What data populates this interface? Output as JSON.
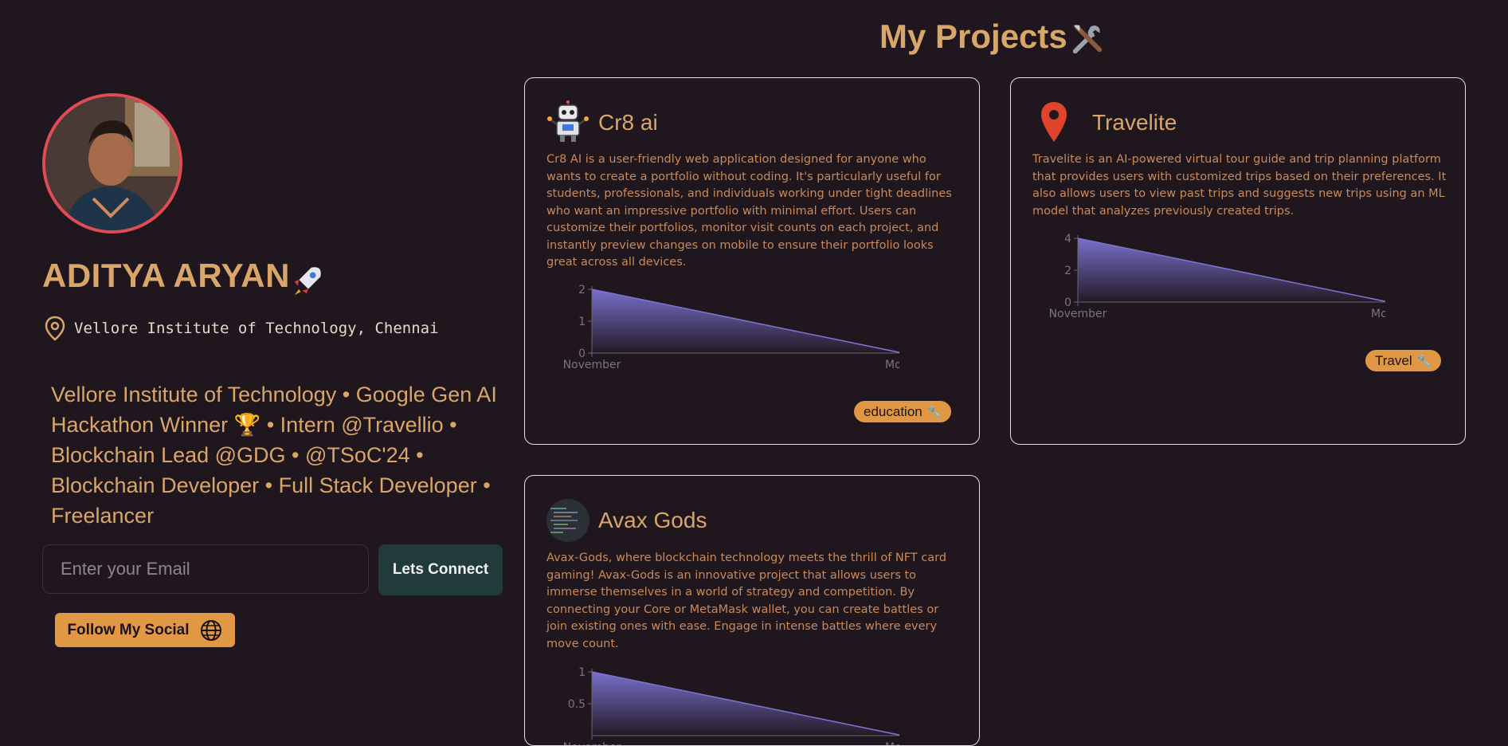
{
  "profile": {
    "name": "ADITYA ARYAN",
    "location": "Vellore Institute of Technology, Chennai",
    "bio": "Vellore Institute of Technology • Google Gen AI Hackathon Winner 🏆 • Intern @Travellio • Blockchain Lead @GDG • @TSoC'24 • Blockchain Developer • Full Stack Developer • Freelancer",
    "email_placeholder": "Enter your Email",
    "connect_label": "Lets Connect",
    "social_label": "Follow My Social"
  },
  "projects_section": {
    "title": "My Projects"
  },
  "projects": [
    {
      "title": "Cr8 ai",
      "description": "Cr8 AI is a user-friendly web application designed for anyone who wants to create a portfolio without coding. It's particularly useful for students, professionals, and individuals working under tight deadlines who want an impressive portfolio with minimal effort. Users can customize their portfolios, monitor visit counts on each project, and instantly preview changes on mobile to ensure their portfolio looks great across all devices.",
      "tag": "education",
      "icon": "robot-icon"
    },
    {
      "title": "Travelite",
      "description": "Travelite is an AI-powered virtual tour guide and trip planning platform that provides users with customized trips based on their preferences. It also allows users to view past trips and suggests new trips using an ML model that analyzes previously created trips.",
      "tag": "Travel",
      "icon": "map-pin-icon"
    },
    {
      "title": "Avax Gods",
      "description": "Avax-Gods, where blockchain technology meets the thrill of NFT card gaming! Avax-Gods is an innovative project that allows users to immerse themselves in a world of strategy and competition. By connecting your Core or MetaMask wallet, you can create battles or join existing ones with ease. Engage in intense battles where every move count.",
      "tag": "",
      "icon": "code-thumbnail-icon"
    }
  ],
  "chart_data": [
    {
      "type": "area",
      "x": [
        "November",
        "Month"
      ],
      "values": [
        2,
        0
      ],
      "yticks": [
        "0",
        "1",
        "2"
      ],
      "ylim": [
        0,
        2
      ],
      "color": "#7d74d4"
    },
    {
      "type": "area",
      "x": [
        "November",
        "Month"
      ],
      "values": [
        4,
        0
      ],
      "yticks": [
        "0",
        "2",
        "4"
      ],
      "ylim": [
        0,
        4
      ],
      "color": "#7d74d4"
    },
    {
      "type": "area",
      "x": [
        "November",
        "Month"
      ],
      "values": [
        1,
        0
      ],
      "yticks": [
        "0.5",
        "1"
      ],
      "ylim": [
        0,
        1
      ],
      "color": "#7d74d4"
    }
  ],
  "colors": {
    "background": "#1f161e",
    "accent": "#d9a66a",
    "button_orange": "#e19845",
    "connect_button": "#213a3a",
    "avatar_ring": "#e04b55"
  }
}
